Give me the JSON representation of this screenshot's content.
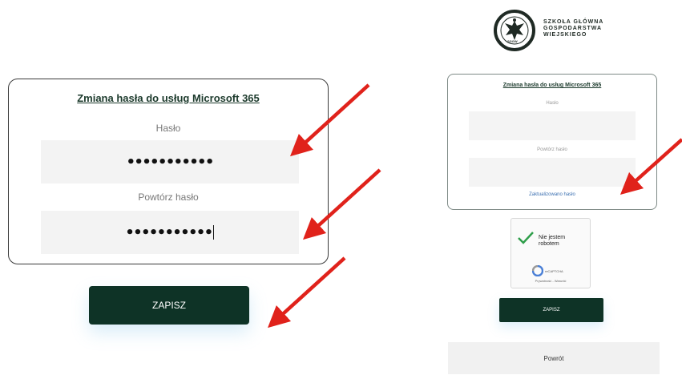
{
  "left_panel": {
    "title": "Zmiana hasła do usług Microsoft 365",
    "password_label": "Hasło",
    "password_value": "•••••••••••",
    "repeat_label": "Powtórz hasło",
    "repeat_value": "•••••••••••",
    "save_label": "ZAPISZ"
  },
  "right_panel": {
    "logo_text": [
      "SZKOŁA GŁÓWNA",
      "GOSPODARSTWA",
      "WIEJSKIEGO"
    ],
    "logo_ring_text": "SGGW",
    "title": "Zmiana hasła do usług Microsoft 365",
    "password_label": "Hasło",
    "repeat_label": "Powtórz hasło",
    "status_link": "Zaktualizowano hasło",
    "captcha": {
      "label_line1": "Nie jestem",
      "label_line2": "robotem",
      "brand": "reCAPTCHA",
      "links": "Prywatność - Warunki"
    },
    "save_label": "ZAPISZ",
    "back_label": "Powrót"
  },
  "colors": {
    "button_bg": "#0e3326",
    "annotation_arrow": "#e0221b",
    "link": "#3a6fb0"
  }
}
